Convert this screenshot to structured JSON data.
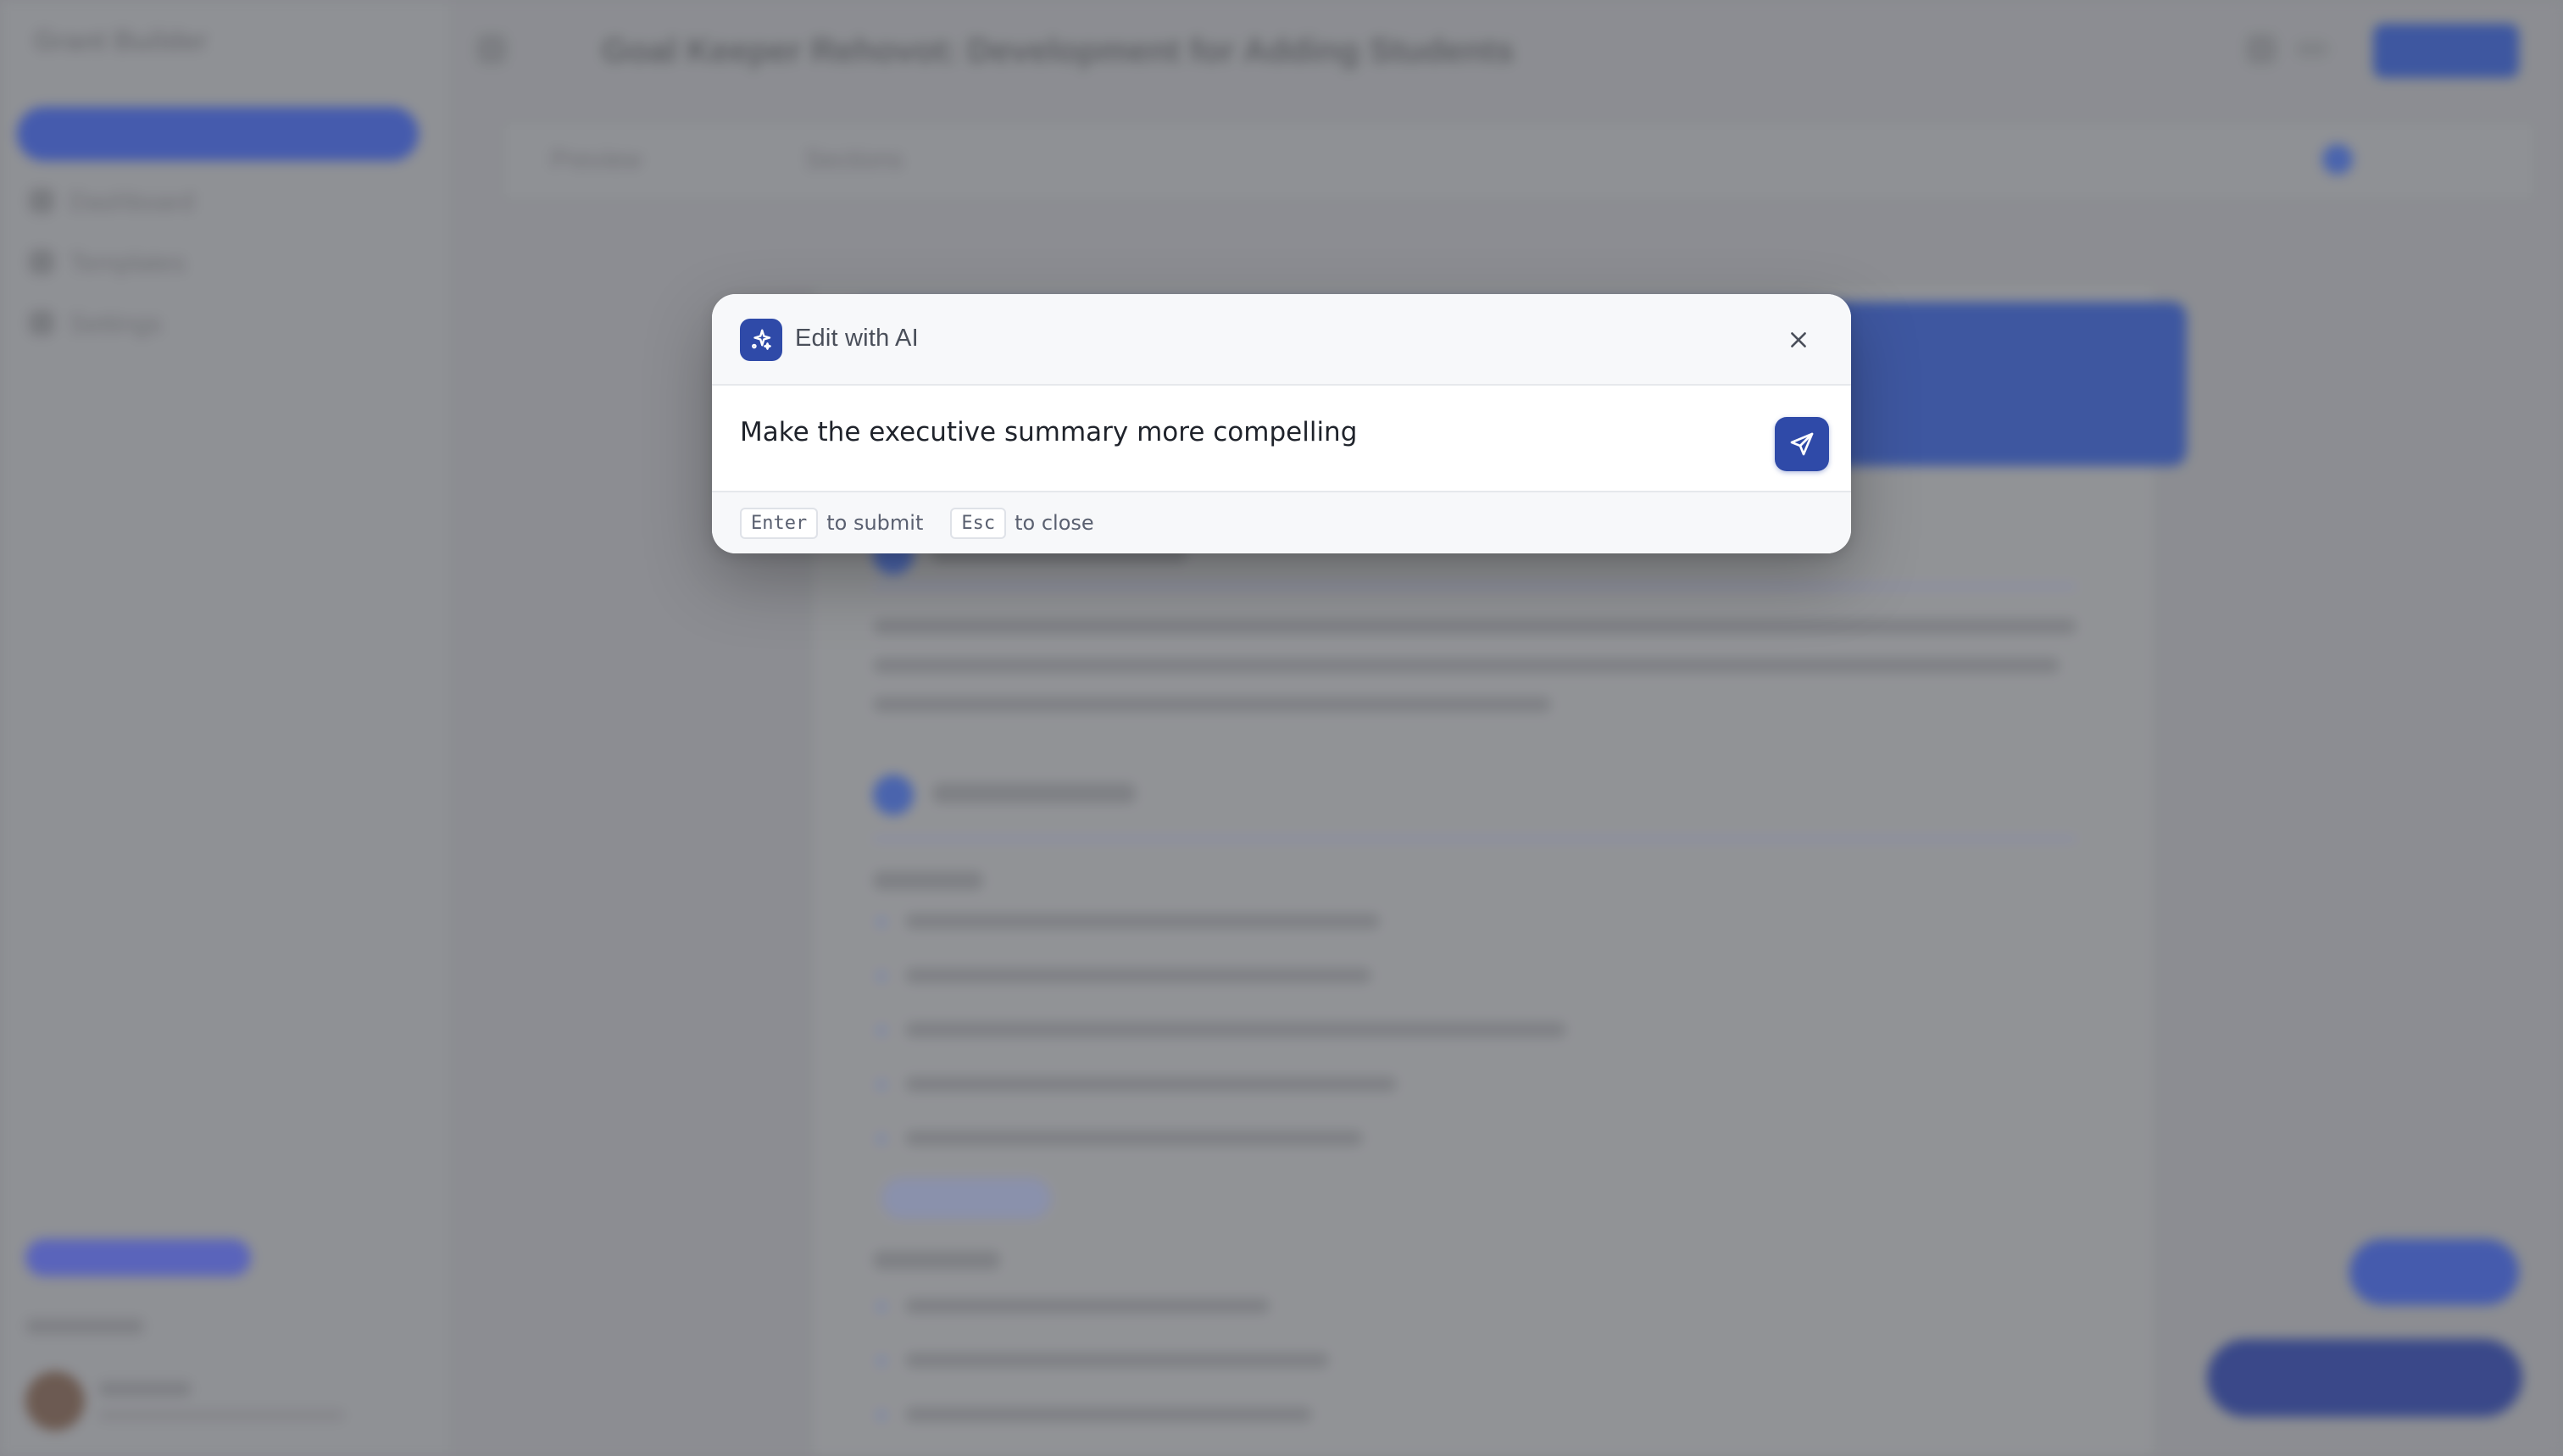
{
  "background": {
    "app_name": "Grant Builder",
    "document_title": "Goal Keeper Rehovot: Development for Adding Students",
    "sidebar_items": [
      "Dashboard",
      "Templates",
      "Settings"
    ],
    "toolbar_tabs": [
      "Preview",
      "Sections"
    ]
  },
  "modal": {
    "title": "Edit with AI",
    "input_value": "Make the executive summary more compelling",
    "input_placeholder": "",
    "footer_hints": [
      {
        "key": "Enter",
        "text": "to submit"
      },
      {
        "key": "Esc",
        "text": "to close"
      }
    ]
  },
  "colors": {
    "accent": "#2f4aa8",
    "modal_bg": "#ffffff",
    "modal_header_bg": "#f7f8fa"
  },
  "icons": {
    "ai_badge": "sparkles-icon",
    "close": "close-icon",
    "send": "send-icon"
  }
}
